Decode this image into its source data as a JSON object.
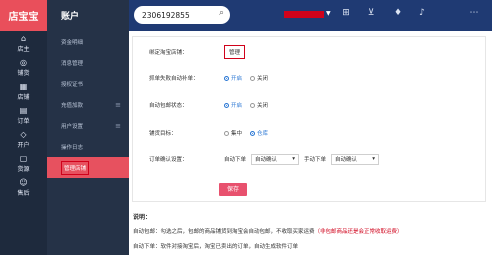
{
  "brand": {
    "name": "店宝宝"
  },
  "rail": [
    {
      "label": "店主",
      "icon": "home-icon"
    },
    {
      "label": "铺货",
      "icon": "compass-icon"
    },
    {
      "label": "店铺",
      "icon": "store-icon"
    },
    {
      "label": "订单",
      "icon": "order-icon"
    },
    {
      "label": "开户",
      "icon": "tag-icon"
    },
    {
      "label": "货源",
      "icon": "box-icon"
    },
    {
      "label": "售后",
      "icon": "user-service-icon"
    }
  ],
  "menu": {
    "title": "账户",
    "items": [
      {
        "label": "资金明细",
        "arrow": ""
      },
      {
        "label": "消息管理",
        "arrow": ""
      },
      {
        "label": "授权证书",
        "arrow": ""
      },
      {
        "label": "充值加款",
        "arrow": "≡"
      },
      {
        "label": "用户设置",
        "arrow": "≡"
      },
      {
        "label": "操作日志",
        "arrow": ""
      },
      {
        "label": "管理店铺",
        "arrow": "",
        "active": true
      }
    ]
  },
  "header": {
    "search_value": "2306192855",
    "icons": [
      "grid-icon",
      "cart-icon",
      "shirt-icon",
      "bell-icon",
      "more-icon"
    ]
  },
  "form": {
    "bound_store_label": "绑定淘宝店铺：",
    "manage_button": "管理",
    "autofill_label": "抓单失败自动补单：",
    "autofill_on": "开启",
    "autofill_off": "关闭",
    "autopay_label": "自动包邮状态：",
    "autopay_on": "开启",
    "autopay_off": "关闭",
    "target_label": "铺货目标：",
    "target_opt1": "集中",
    "target_opt2": "仓库",
    "order_confirm_label": "订单确认设置：",
    "auto_order_label": "自动下单",
    "auto_order_value": "自动确认",
    "manual_order_label": "手动下单",
    "manual_order_value": "自动确认",
    "save_button": "保存"
  },
  "description": {
    "title": "说明：",
    "line1_prefix": "自动包邮：勾选之后，包邮的商品铺货到淘宝会自动包邮，不收取买家运费",
    "line1_red": "（非包邮商品还是会正常收取运费）",
    "line2": "自动下单：软件对接淘宝后，淘宝已卖出的订单，自动生成软件订单"
  }
}
